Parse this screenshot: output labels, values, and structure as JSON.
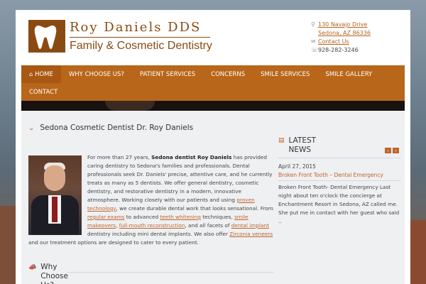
{
  "logo": {
    "line1": "Roy Daniels DDS",
    "line2": "Family & Cosmetic Dentistry",
    "brand_color": "#8a4b13"
  },
  "contact": {
    "address_line1": "130 Navajo Drive",
    "address_line2": "Sedona, AZ 86336",
    "contact_link": "Contact Us",
    "phone": "928-282-3246",
    "icons": [
      "map-pin-icon",
      "envelope-icon",
      "phone-icon"
    ]
  },
  "nav": {
    "color": "#b8661a",
    "items": [
      {
        "label": "Home",
        "active": true
      },
      {
        "label": "Why Choose Us?"
      },
      {
        "label": "Patient Services"
      },
      {
        "label": "Concerns"
      },
      {
        "label": "Smile Services"
      },
      {
        "label": "Smile Gallery"
      },
      {
        "label": "Contact"
      }
    ]
  },
  "main": {
    "title": "Sedona Cosmetic Dentist Dr. Roy Daniels",
    "intro": "For more than 27 years, ",
    "intro_bold": "Sedona dentist Roy Daniels",
    "p1": " has provided caring dentistry to Sedona's families and professionals. Dental professionals seek Dr. Daniels' precise, attentive care, and he currently treats as many as 5 dentists. We offer general dentistry, cosmetic dentistry, and restorative dentistry in a modern, innovative atmosphere. Working closely with our patients and using ",
    "link1": "proven technology",
    "p2": ", we create durable dental work that looks sensational. From ",
    "link2": "regular exams",
    "p3": " to advanced ",
    "link3": "teeth whitening",
    "p4": " techniques, ",
    "link4": "smile makeovers",
    "p5": ", ",
    "link5": "full-mouth reconstruction",
    "p6": ", and all facets of ",
    "link6": "dental implant",
    "p7": " dentistry including mini dental implants. We also offer ",
    "link7": "Zirconia veneers",
    "p8": " and our treatment options are designed to cater to every patient.",
    "why_title": "Why Choose Us?"
  },
  "sidebar": {
    "title": "LATEST NEWS",
    "prev": "‹",
    "next": "›",
    "date": "April 27, 2015",
    "headline": "Broken Front Tooth – Dental Emergency",
    "excerpt": "Broken Front Tooth- Dental Emergency Last night about ten o'clock the concierge at Enchantment Resort in Sedona, AZ called me. She put me in contact with her guest who said .."
  },
  "accent_color": "#c0642a"
}
